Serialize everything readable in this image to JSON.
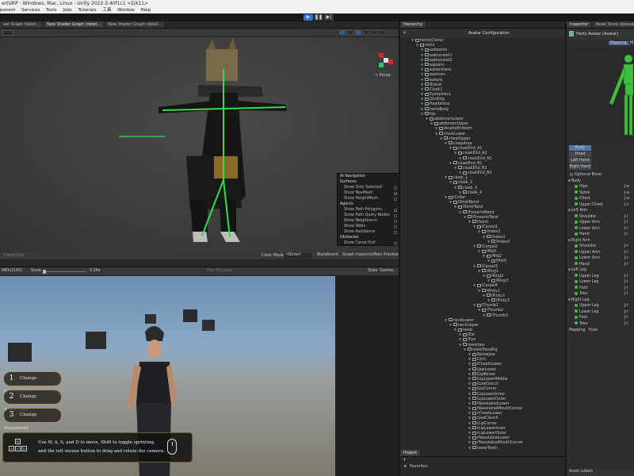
{
  "window": {
    "title": "ertURP - Windows, Mac, Linux - Unity 2022.3.40f1c1 <DX11>"
  },
  "menu": [
    "ponent",
    "Services",
    "Tools",
    "Jobs",
    "Tutorials",
    "工具",
    "Window",
    "Help"
  ],
  "top_tabs": [
    "aer Graph (delet...",
    "New Shader Graph (delet...",
    "New Shader Graph (delet..."
  ],
  "scene": {
    "persp_label": "< Persp",
    "bottom_left": "Check Out",
    "color_mode_label": "Color Mode",
    "color_mode_value": "<None>",
    "bottom_tabs": [
      "Blackboard",
      "Graph Inspector",
      "Main Preview"
    ]
  },
  "ai_nav": {
    "title": "AI Navigation",
    "surfaces_header": "Surfaces",
    "surfaces": [
      {
        "label": "Show Only Selected",
        "checked": false
      },
      {
        "label": "Show NavMesh",
        "checked": true
      },
      {
        "label": "Show HeightMesh",
        "checked": false
      }
    ],
    "agents_header": "Agents",
    "agents": [
      {
        "label": "Show Path Polygons",
        "checked": true
      },
      {
        "label": "Show Path Query Nodes",
        "checked": false
      },
      {
        "label": "Show Neighbours",
        "checked": false
      },
      {
        "label": "Show Walls",
        "checked": false
      },
      {
        "label": "Show Avoidance",
        "checked": false
      }
    ],
    "obstacles_header": "Obstacles",
    "obstacles": [
      {
        "label": "Show Carve Hull",
        "checked": false
      }
    ]
  },
  "game": {
    "resolution": "480x2160)",
    "scale_label": "Scale",
    "scale_value": "0.29x",
    "play_focused": "Play Focused",
    "stats": "Stats",
    "gizmos": "Gizmos",
    "buttons": [
      {
        "num": "1",
        "label": "Change Equipment"
      },
      {
        "num": "2",
        "label": "Change Equipment"
      },
      {
        "num": "3",
        "label": "Change Equipment"
      }
    ],
    "hint_line1": "Use W, A, S, and D to move, Shift to toggle sprinting,",
    "hint_line2": "and the left mouse button to drag and rotate the camera.",
    "keys": [
      "W",
      "A",
      "S",
      "D"
    ]
  },
  "hierarchy": {
    "tab": "Hierarchy",
    "add": "+",
    "avatar_config": "Avatar Configuration",
    "rows": [
      {
        "t": "hertz(Clone)",
        "d": 0
      },
      {
        "t": "hertz",
        "d": 1
      },
      {
        "t": "aabeams",
        "d": 2
      },
      {
        "t": "aabracelet1",
        "d": 2
      },
      {
        "t": "aabracelet2",
        "d": 2
      },
      {
        "t": "aajeans",
        "d": 2
      },
      {
        "t": "aanecklace",
        "d": 2
      },
      {
        "t": "aashoes",
        "d": 2
      },
      {
        "t": "aatank",
        "d": 2
      },
      {
        "t": "Bracer",
        "d": 2
      },
      {
        "t": "Cloak1",
        "d": 2
      },
      {
        "t": "Eyelashes1",
        "d": 2
      },
      {
        "t": "Girdling",
        "d": 2
      },
      {
        "t": "Headdress",
        "d": 2
      },
      {
        "t": "hertzBody",
        "d": 2
      },
      {
        "t": "hip",
        "d": 2
      },
      {
        "t": "abdomenLower",
        "d": 3
      },
      {
        "t": "abdomenUpper",
        "d": 4
      },
      {
        "t": "AnubisEmblem",
        "d": 5
      },
      {
        "t": "chestLower",
        "d": 5
      },
      {
        "t": "chestUpper",
        "d": 6
      },
      {
        "t": "claspArea",
        "d": 7
      },
      {
        "t": "cloakEnd_A1",
        "d": 8
      },
      {
        "t": "cloakEnd_A2",
        "d": 9
      },
      {
        "t": "cloakEnd_A3",
        "d": 10
      },
      {
        "t": "cloakEnd_B1",
        "d": 8
      },
      {
        "t": "cloakEnd_B2",
        "d": 9
      },
      {
        "t": "cloakEnd_B3",
        "d": 10
      },
      {
        "t": "cloak_1",
        "d": 7
      },
      {
        "t": "cloak_2",
        "d": 8
      },
      {
        "t": "cloak_3",
        "d": 9
      },
      {
        "t": "cloak_4",
        "d": 10
      },
      {
        "t": "lCollar",
        "d": 7
      },
      {
        "t": "lShldrBend",
        "d": 8
      },
      {
        "t": "lShldrTwist",
        "d": 9
      },
      {
        "t": "lForearmBend",
        "d": 10
      },
      {
        "t": "lForearmTwist",
        "d": 11
      },
      {
        "t": "lHand",
        "d": 12
      },
      {
        "t": "lCarpal1",
        "d": 13
      },
      {
        "t": "lIndex1",
        "d": 14
      },
      {
        "t": "lIndex2",
        "d": 15
      },
      {
        "t": "lIndex3",
        "d": 16
      },
      {
        "t": "lCarpal2",
        "d": 13
      },
      {
        "t": "lMid1",
        "d": 14
      },
      {
        "t": "lMid2",
        "d": 15
      },
      {
        "t": "lMid3",
        "d": 16
      },
      {
        "t": "lCarpal3",
        "d": 13
      },
      {
        "t": "lRing1",
        "d": 14
      },
      {
        "t": "lRing2",
        "d": 15
      },
      {
        "t": "lRing3",
        "d": 16
      },
      {
        "t": "lCarpal4",
        "d": 13
      },
      {
        "t": "lPinky1",
        "d": 14
      },
      {
        "t": "lPinky2",
        "d": 15
      },
      {
        "t": "lPinky3",
        "d": 16
      },
      {
        "t": "lThumb1",
        "d": 13
      },
      {
        "t": "lThumb2",
        "d": 14
      },
      {
        "t": "lThumb3",
        "d": 15
      },
      {
        "t": "neckLower",
        "d": 7
      },
      {
        "t": "neckUpper",
        "d": 8
      },
      {
        "t": "head",
        "d": 9
      },
      {
        "t": "lEar",
        "d": 10
      },
      {
        "t": "lEye",
        "d": 10
      },
      {
        "t": "lowerJaw",
        "d": 10
      },
      {
        "t": "lowerFaceRig",
        "d": 11
      },
      {
        "t": "BelowJaw",
        "d": 12
      },
      {
        "t": "Chin",
        "d": 12
      },
      {
        "t": "lCheekLower",
        "d": 12
      },
      {
        "t": "lJawLower",
        "d": 12
      },
      {
        "t": "lLipBelow",
        "d": 12
      },
      {
        "t": "lLipLowerMiddle",
        "d": 12
      },
      {
        "t": "lLowClench",
        "d": 12
      },
      {
        "t": "lLipCorner",
        "d": 12
      },
      {
        "t": "lLipLowerInner",
        "d": 12
      },
      {
        "t": "lLipLowerOuter",
        "d": 12
      },
      {
        "t": "lNasolabialLower",
        "d": 12
      },
      {
        "t": "lNasolabialMouthCorner",
        "d": 12
      },
      {
        "t": "rCheekLower",
        "d": 12
      },
      {
        "t": "rJawClench",
        "d": 12
      },
      {
        "t": "rLipCorner",
        "d": 12
      },
      {
        "t": "rLipLowerInner",
        "d": 12
      },
      {
        "t": "rLipLowerOuter",
        "d": 12
      },
      {
        "t": "rNasolabialLower",
        "d": 12
      },
      {
        "t": "rNasolabialMouthCorner",
        "d": 12
      },
      {
        "t": "lowerTeeth",
        "d": 12
      }
    ]
  },
  "project": {
    "tab": "Project",
    "add": "+",
    "favorites": "Favorites"
  },
  "inspector": {
    "tabs": [
      "Inspector",
      "Asset Store Uploader"
    ],
    "title": "Hertz Avatar (Avatar)",
    "modes": [
      "Mapping",
      "M"
    ],
    "body_buttons": [
      "Body",
      "Head",
      "Left Hand",
      "Right Hand"
    ],
    "optional_bone": "Optional Bone",
    "groups": [
      {
        "name": "Body",
        "bones": [
          {
            "n": "Hips",
            "v": "J-a"
          },
          {
            "n": "Spine",
            "v": "J-a"
          },
          {
            "n": "Chest",
            "v": "J-a"
          },
          {
            "n": "Upper Chest",
            "v": "J-c"
          }
        ]
      },
      {
        "name": "Left Arm",
        "bones": [
          {
            "n": "Shoulder",
            "v": "J-l"
          },
          {
            "n": "Upper Arm",
            "v": "J-l"
          },
          {
            "n": "Lower Arm",
            "v": "J-l"
          },
          {
            "n": "Hand",
            "v": "J-l"
          }
        ]
      },
      {
        "name": "Right Arm",
        "bones": [
          {
            "n": "Shoulder",
            "v": "J-r"
          },
          {
            "n": "Upper Arm",
            "v": "J-r"
          },
          {
            "n": "Lower Arm",
            "v": "J-r"
          },
          {
            "n": "Hand",
            "v": "J-r"
          }
        ]
      },
      {
        "name": "Left Leg",
        "bones": [
          {
            "n": "Upper Leg",
            "v": "J-l"
          },
          {
            "n": "Lower Leg",
            "v": "J-l"
          },
          {
            "n": "Foot",
            "v": "J-l"
          },
          {
            "n": "Toes",
            "v": "J-l"
          }
        ]
      },
      {
        "name": "Right Leg",
        "bones": [
          {
            "n": "Upper Leg",
            "v": "J-r"
          },
          {
            "n": "Lower Leg",
            "v": "J-r"
          },
          {
            "n": "Foot",
            "v": "J-r"
          },
          {
            "n": "Toes",
            "v": "J-r"
          }
        ]
      }
    ],
    "footer_mapping": "Mapping",
    "footer_pose": "Pose",
    "asset_labels": "Asset Labels"
  },
  "colors": {
    "accent": "#2f6fd6",
    "bone_ok": "#39c53b",
    "panel": "#282828"
  }
}
